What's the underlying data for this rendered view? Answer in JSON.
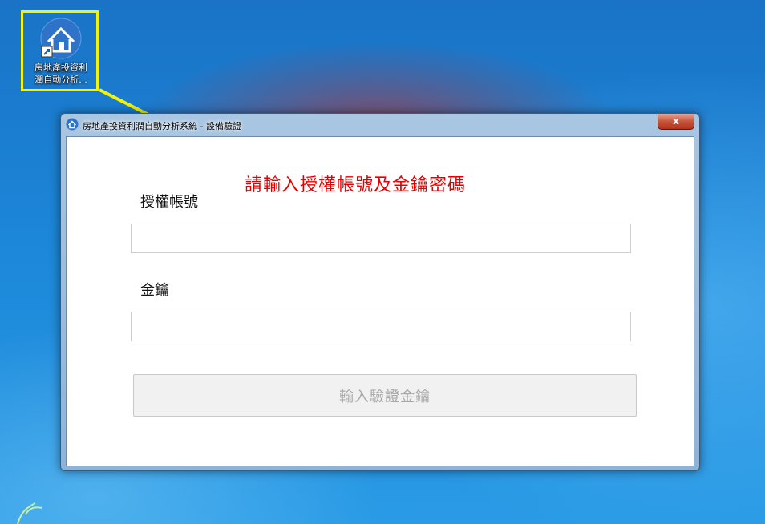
{
  "desktop": {
    "shortcut_label_line1": "房地產投資利",
    "shortcut_label_line2": "潤自動分析...",
    "highlight_color": "#f2f20a"
  },
  "window": {
    "title": "房地產投資利潤自動分析系統 - 設備驗證",
    "close_label": "x",
    "instruction": "請輸入授權帳號及金鑰密碼",
    "instruction_color": "#e80000",
    "account_label": "授權帳號",
    "account_value": "",
    "key_label": "金鑰",
    "key_value": "",
    "submit_label": "輸入驗證金鑰"
  }
}
